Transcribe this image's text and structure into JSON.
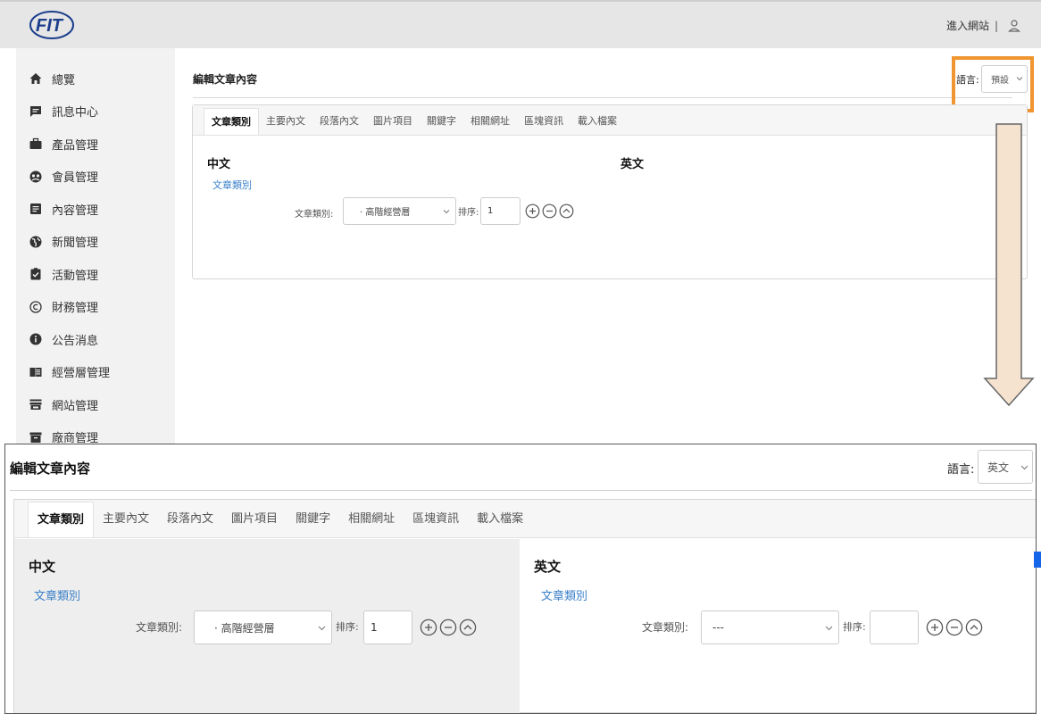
{
  "header": {
    "logo_text": "FIT",
    "enter_site": "進入網站",
    "separator": "|"
  },
  "sidebar": {
    "items": [
      {
        "label": "總覽",
        "icon": "home-icon"
      },
      {
        "label": "訊息中心",
        "icon": "message-icon"
      },
      {
        "label": "產品管理",
        "icon": "briefcase-icon"
      },
      {
        "label": "會員管理",
        "icon": "member-icon"
      },
      {
        "label": "內容管理",
        "icon": "document-icon"
      },
      {
        "label": "新聞管理",
        "icon": "globe-icon"
      },
      {
        "label": "活動管理",
        "icon": "clipboard-check-icon"
      },
      {
        "label": "財務管理",
        "icon": "copyright-icon"
      },
      {
        "label": "公告消息",
        "icon": "info-icon"
      },
      {
        "label": "經營層管理",
        "icon": "book-icon"
      },
      {
        "label": "網站管理",
        "icon": "store-icon"
      },
      {
        "label": "廠商管理",
        "icon": "archive-icon"
      }
    ]
  },
  "editor": {
    "title": "編輯文章內容",
    "language_label": "語言:",
    "language_value": "預設",
    "tabs": [
      "文章類別",
      "主要內文",
      "段落內文",
      "圖片項目",
      "關鍵字",
      "相關網址",
      "區塊資訊",
      "載入檔案"
    ],
    "active_tab": 0,
    "chinese": {
      "heading": "中文",
      "sub_link": "文章類別",
      "category_label": "文章類別:",
      "category_value": "· 高階經營層",
      "order_label": "排序:",
      "order_value": "1"
    },
    "english": {
      "heading": "英文"
    }
  },
  "zoom": {
    "title": "編輯文章內容",
    "language_label": "語言:",
    "language_value": "英文",
    "tabs": [
      "文章類別",
      "主要內文",
      "段落內文",
      "圖片項目",
      "關鍵字",
      "相關網址",
      "區塊資訊",
      "載入檔案"
    ],
    "chinese": {
      "heading": "中文",
      "sub_link": "文章類別",
      "category_label": "文章類別:",
      "category_value": "· 高階經營層",
      "order_label": "排序:",
      "order_value": "1"
    },
    "english": {
      "heading": "英文",
      "sub_link": "文章類別",
      "category_label": "文章類別:",
      "category_value": "---",
      "order_label": "排序:",
      "order_value": ""
    }
  },
  "colors": {
    "highlight": "#f0952f",
    "link": "#3a7fc8",
    "arrow_fill": "#f5e3cf",
    "accent_blue": "#1565e8"
  }
}
